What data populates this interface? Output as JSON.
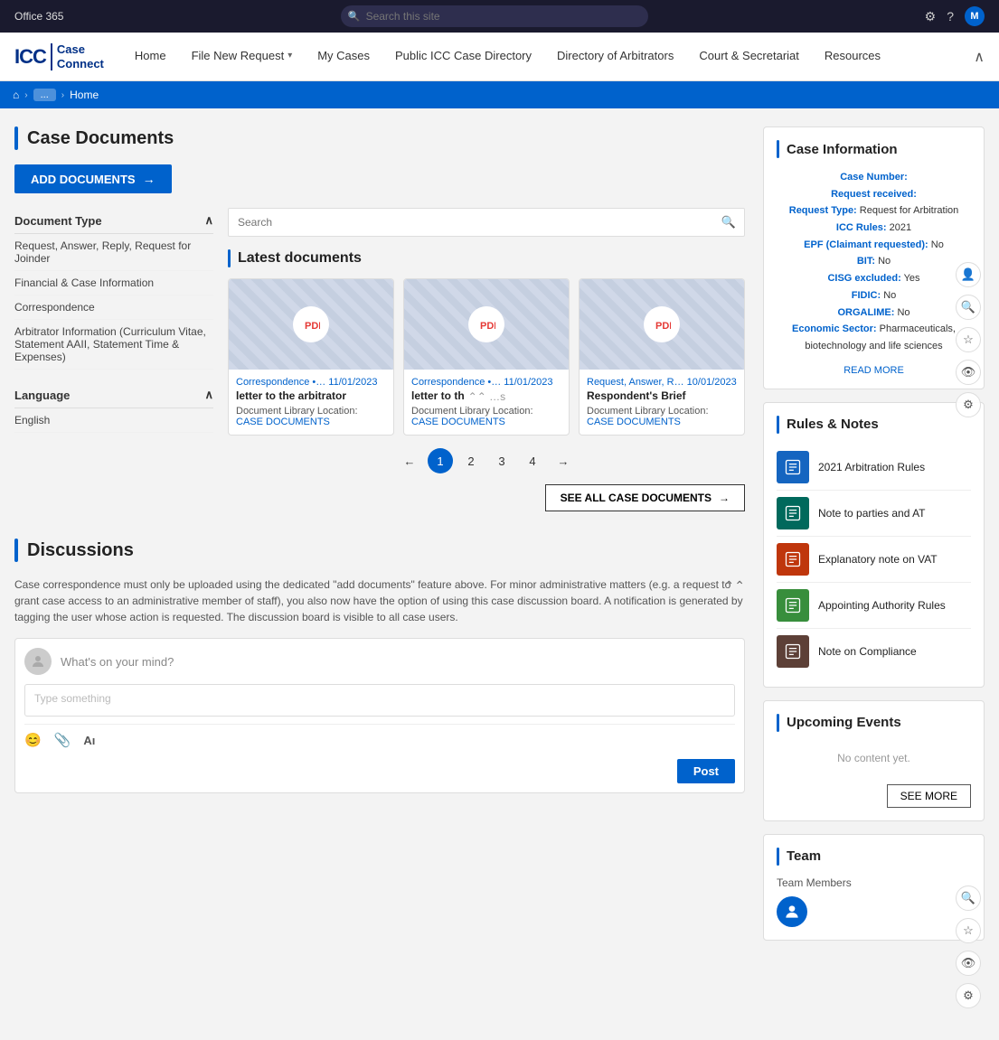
{
  "topBar": {
    "title": "Office 365",
    "searchPlaceholder": "Search this site",
    "icons": {
      "gear": "⚙",
      "help": "?",
      "avatar": "M"
    }
  },
  "nav": {
    "logo": {
      "icc": "ICC",
      "bar": "|",
      "appName": "Case Connect"
    },
    "links": [
      {
        "label": "Home",
        "hasDropdown": false
      },
      {
        "label": "File New Request",
        "hasDropdown": true
      },
      {
        "label": "My Cases",
        "hasDropdown": false
      },
      {
        "label": "Public ICC Case Directory",
        "hasDropdown": false
      },
      {
        "label": "Directory of Arbitrators",
        "hasDropdown": false
      },
      {
        "label": "Court & Secretariat",
        "hasDropdown": false
      },
      {
        "label": "Resources",
        "hasDropdown": false
      }
    ],
    "expandIcon": "∧"
  },
  "breadcrumb": {
    "homeIcon": "⌂",
    "pill": "...",
    "current": "Home"
  },
  "caseDocuments": {
    "title": "Case Documents",
    "addButton": "ADD DOCUMENTS",
    "searchPlaceholder": "Search",
    "latestTitle": "Latest documents",
    "seeAllButton": "SEE ALL CASE DOCUMENTS",
    "filters": {
      "docTypeLabel": "Document Type",
      "docTypes": [
        "Request, Answer, Reply, Request for Joinder",
        "Financial & Case Information",
        "Correspondence",
        "Arbitrator Information (Curriculum Vitae, Statement AAII, Statement Time & Expenses)"
      ],
      "languageLabel": "Language",
      "languages": [
        "English"
      ]
    },
    "cards": [
      {
        "type": "Correspondence •… 11/01/2023",
        "name": "letter to the arbitrator",
        "locLabel": "Document Library Location:",
        "locLink": "CASE DOCUMENTS"
      },
      {
        "type": "Correspondence •… 11/01/2023",
        "name": "letter to th",
        "locLabel": "Document Library Location:",
        "locLink": "CASE DOCUMENTS"
      },
      {
        "type": "Request, Answer, R… 10/01/2023",
        "name": "Respondent's Brief",
        "locLabel": "Document Library Location:",
        "locLink": "CASE DOCUMENTS"
      }
    ],
    "pagination": {
      "prev": "←",
      "pages": [
        "1",
        "2",
        "3",
        "4"
      ],
      "next": "→",
      "active": "1"
    }
  },
  "discussions": {
    "title": "Discussions",
    "description": "Case correspondence must only be uploaded using the dedicated \"add documents\" feature above. For minor administrative matters (e.g. a request to grant case access to an administrative member of staff), you also now have the option of using this case discussion board. A notification is generated by tagging the user whose action is requested. The discussion board is visible to all case users.",
    "commentPrompt": "What's on your mind?",
    "commentPlaceholder": "Type something",
    "postButton": "Post",
    "icons": {
      "emoji": "😊",
      "attach": "📎",
      "format": "Aı"
    }
  },
  "caseInformation": {
    "title": "Case Information",
    "fields": [
      {
        "label": "Case Number:",
        "value": ""
      },
      {
        "label": "Request received:",
        "value": ""
      },
      {
        "label": "Request Type:",
        "value": "Request for Arbitration"
      },
      {
        "label": "ICC Rules:",
        "value": "2021"
      },
      {
        "label": "EPF (Claimant requested):",
        "value": "No"
      },
      {
        "label": "BIT:",
        "value": "No"
      },
      {
        "label": "CISG excluded:",
        "value": "Yes"
      },
      {
        "label": "FIDIC:",
        "value": "No"
      },
      {
        "label": "ORGALIME:",
        "value": "No"
      },
      {
        "label": "Economic Sector:",
        "value": "Pharmaceuticals, biotechnology and life sciences"
      }
    ],
    "readMore": "READ MORE"
  },
  "rulesNotes": {
    "title": "Rules & Notes",
    "items": [
      {
        "name": "2021 Arbitration Rules",
        "color": "rt-blue"
      },
      {
        "name": "Note to parties and AT",
        "color": "rt-teal"
      },
      {
        "name": "Explanatory note on VAT",
        "color": "rt-amber"
      },
      {
        "name": "Appointing Authority Rules",
        "color": "rt-green"
      },
      {
        "name": "Note on Compliance",
        "color": "rt-brown"
      }
    ]
  },
  "upcomingEvents": {
    "title": "Upcoming Events",
    "noContent": "No content yet.",
    "seeMore": "SEE MORE"
  },
  "team": {
    "title": "Team",
    "membersLabel": "Team Members",
    "avatarIcon": "👤"
  },
  "floatingIcons": [
    {
      "name": "user-panel-icon",
      "symbol": "👤"
    },
    {
      "name": "search-panel-icon",
      "symbol": "🔍"
    },
    {
      "name": "star-panel-icon",
      "symbol": "☆"
    },
    {
      "name": "eye-panel-icon",
      "symbol": "👁"
    },
    {
      "name": "gear-panel-icon",
      "symbol": "⚙"
    }
  ]
}
